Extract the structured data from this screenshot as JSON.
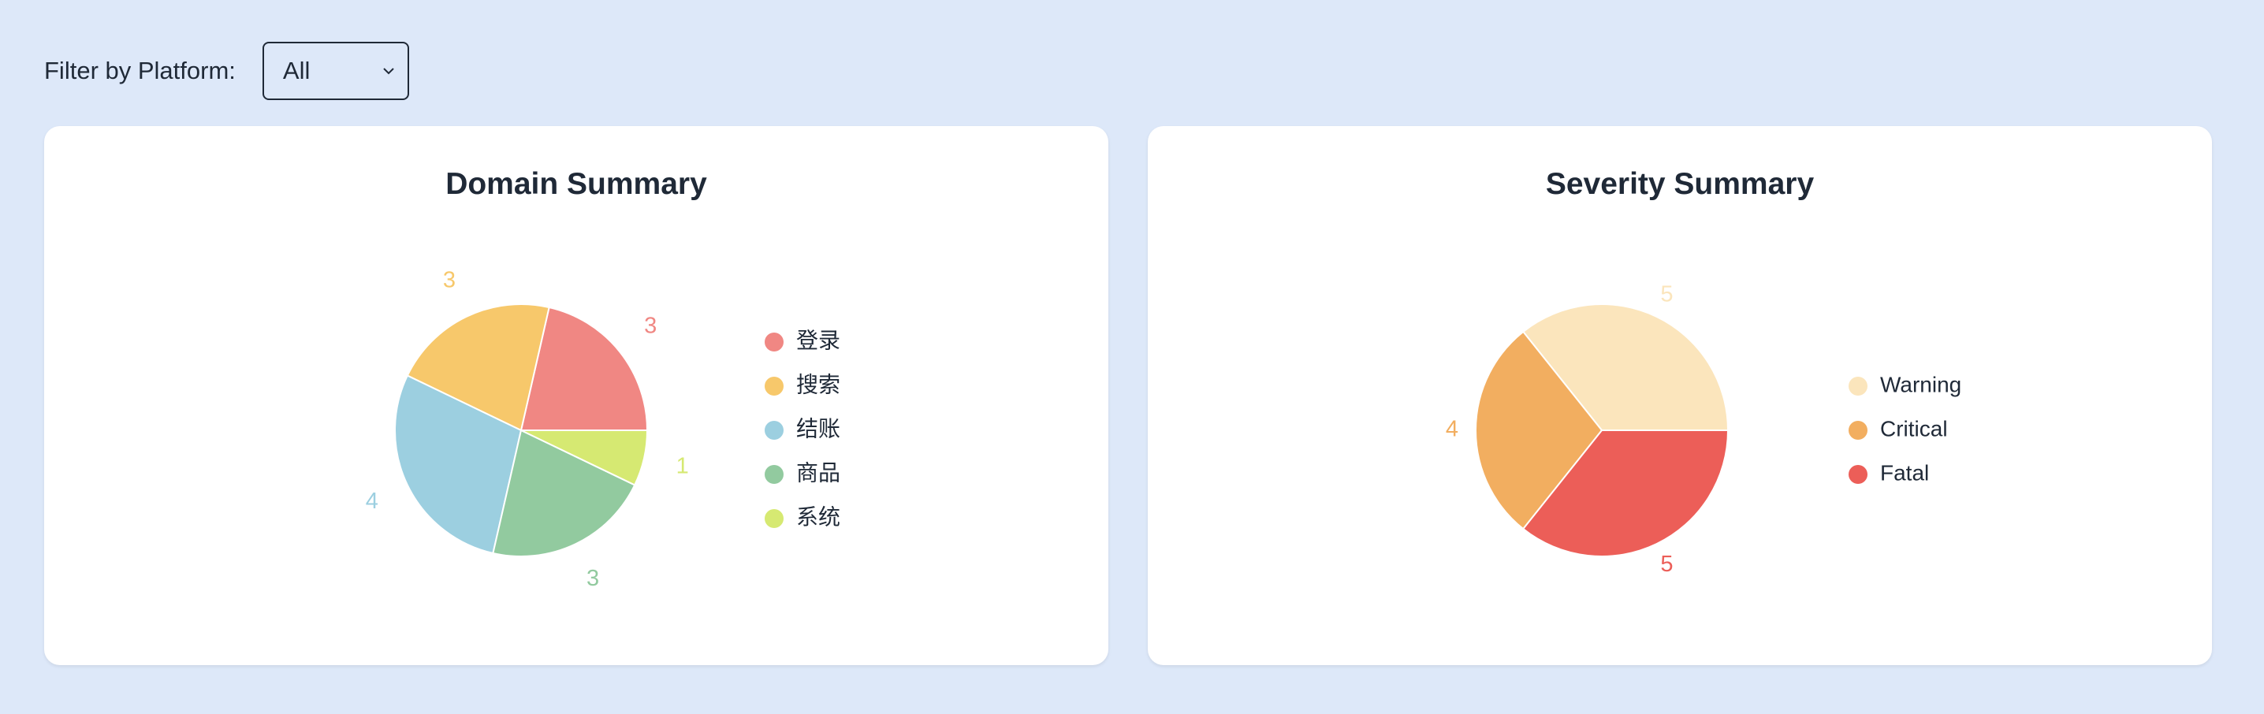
{
  "filter": {
    "label": "Filter by Platform:",
    "selected": "All"
  },
  "chart_data": [
    {
      "type": "pie",
      "title": "Domain Summary",
      "categories": [
        "登录",
        "搜索",
        "结账",
        "商品",
        "系统"
      ],
      "values": [
        3,
        3,
        4,
        3,
        1
      ],
      "colors": [
        "#f08783",
        "#f7c86b",
        "#9ccfe0",
        "#92ca9f",
        "#d6e972"
      ],
      "legend": "right"
    },
    {
      "type": "pie",
      "title": "Severity Summary",
      "categories": [
        "Warning",
        "Critical",
        "Fatal"
      ],
      "values": [
        5,
        4,
        5
      ],
      "colors": [
        "#fbe5bc",
        "#f2ae60",
        "#ec5e58"
      ],
      "legend": "right"
    }
  ]
}
